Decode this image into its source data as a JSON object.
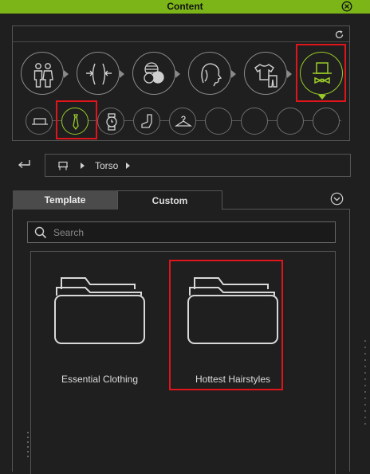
{
  "window": {
    "title": "Content"
  },
  "icon_panel": {
    "categories": [
      {
        "name": "body",
        "icon": "people-icon",
        "active": false
      },
      {
        "name": "morph",
        "icon": "morph-icon",
        "active": false
      },
      {
        "name": "material",
        "icon": "spheres-icon",
        "active": false
      },
      {
        "name": "head",
        "icon": "head-icon",
        "active": false
      },
      {
        "name": "clothing",
        "icon": "clothes-icon",
        "active": false
      },
      {
        "name": "accessories",
        "icon": "hat-bowtie-icon",
        "active": true
      }
    ],
    "sub_items": [
      {
        "icon": "hat-icon",
        "active": false
      },
      {
        "icon": "tie-icon",
        "active": true
      },
      {
        "icon": "watch-icon",
        "active": false
      },
      {
        "icon": "sock-icon",
        "active": false
      },
      {
        "icon": "hanger-icon",
        "active": false
      },
      {
        "icon": "empty",
        "active": false
      },
      {
        "icon": "empty",
        "active": false
      },
      {
        "icon": "empty",
        "active": false
      },
      {
        "icon": "empty",
        "active": false
      }
    ]
  },
  "breadcrumb": {
    "label": "Torso"
  },
  "tabs": {
    "template": "Template",
    "custom": "Custom",
    "active": "Template"
  },
  "search": {
    "placeholder": "Search",
    "value": ""
  },
  "folders": [
    {
      "label": "Essential Clothing"
    },
    {
      "label": "Hottest Hairstyles"
    }
  ],
  "colors": {
    "accent": "#9acb28",
    "titlebar": "#7cb518",
    "highlight": "#e0141b"
  }
}
